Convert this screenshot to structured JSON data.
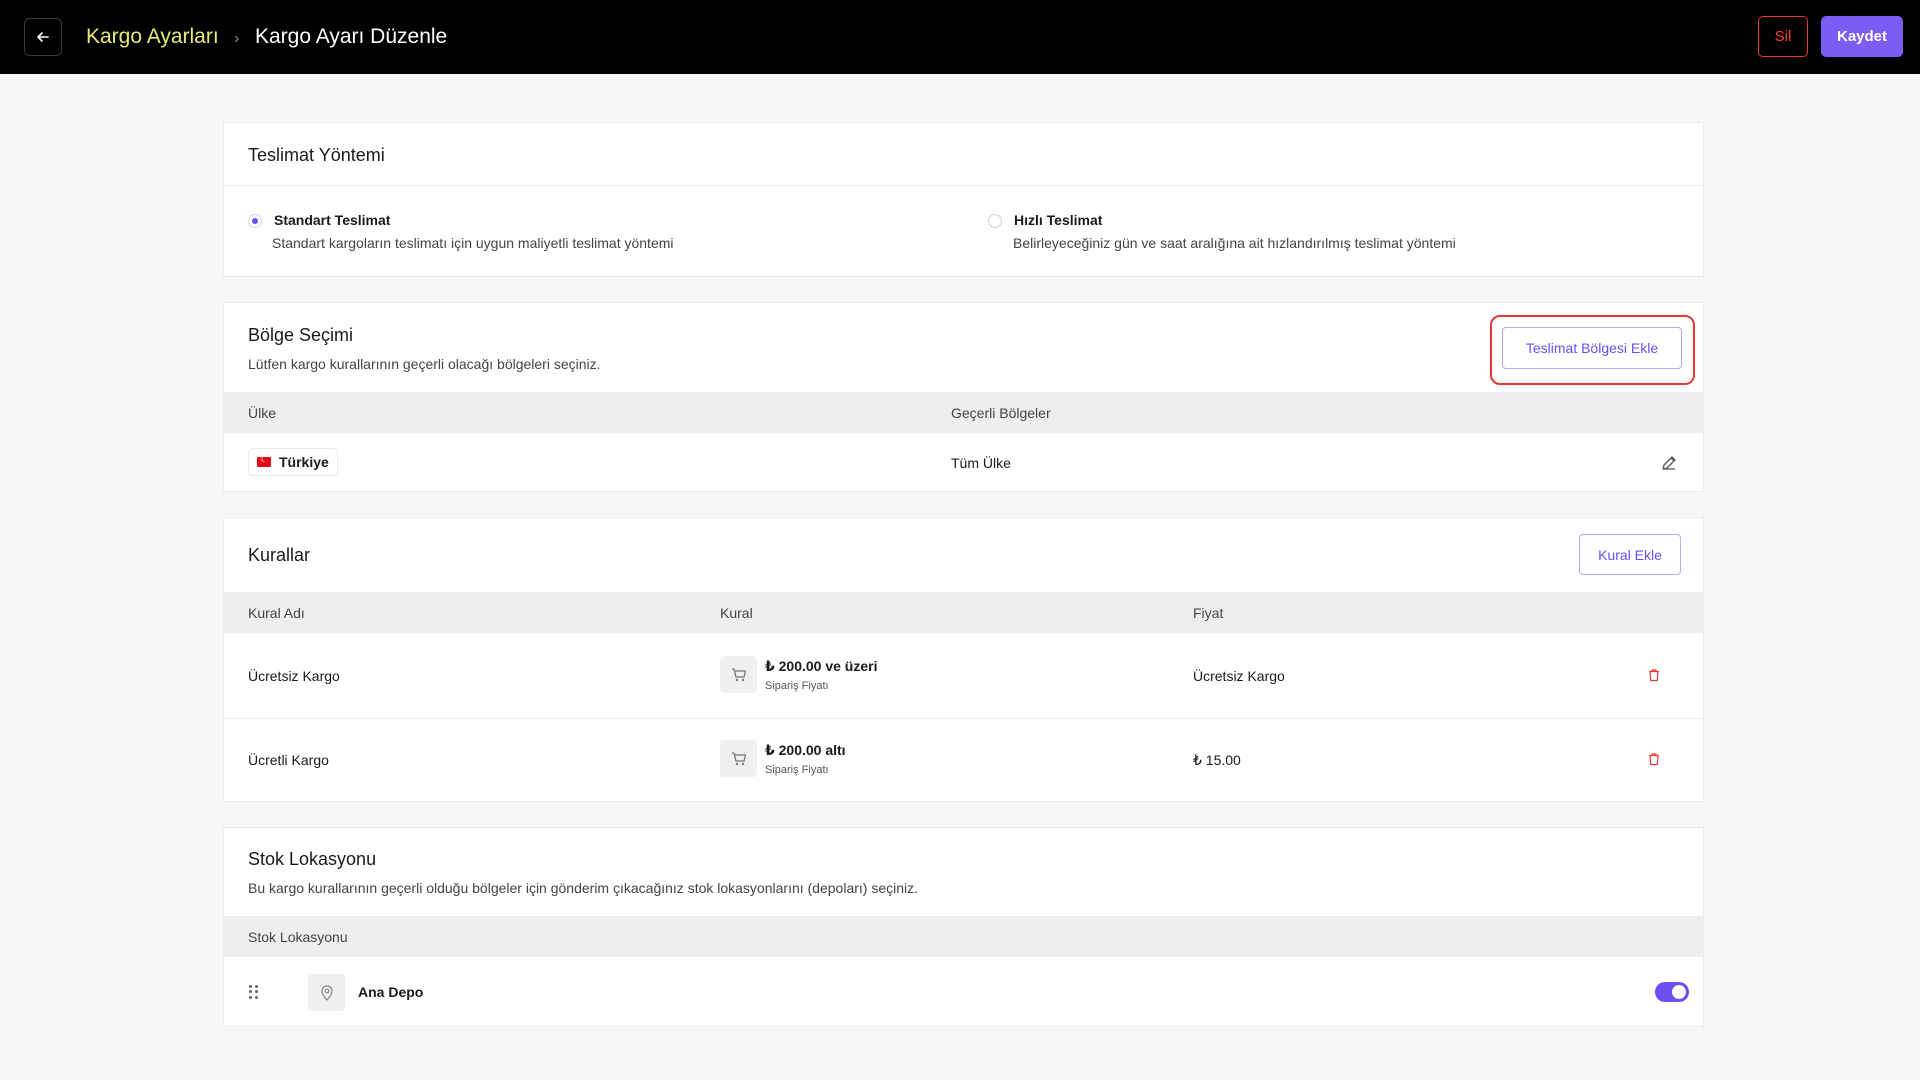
{
  "header": {
    "back_icon": "arrow-left-icon",
    "breadcrumb_parent": "Kargo Ayarları",
    "breadcrumb_separator": "›",
    "breadcrumb_current": "Kargo Ayarı Düzenle",
    "delete_label": "Sil",
    "save_label": "Kaydet"
  },
  "delivery_method": {
    "title": "Teslimat Yöntemi",
    "options": [
      {
        "label": "Standart Teslimat",
        "description": "Standart kargoların teslimatı için uygun maliyetli teslimat yöntemi",
        "selected": true
      },
      {
        "label": "Hızlı Teslimat",
        "description": "Belirleyeceğiniz gün ve saat aralığına ait hızlandırılmış teslimat yöntemi",
        "selected": false
      }
    ]
  },
  "region": {
    "title": "Bölge Seçimi",
    "subtitle": "Lütfen kargo kurallarının geçerli olacağı bölgeleri seçiniz.",
    "add_button": "Teslimat Bölgesi Ekle",
    "columns": [
      "Ülke",
      "Geçerli Bölgeler"
    ],
    "rows": [
      {
        "country": "Türkiye",
        "regions": "Tüm Ülke"
      }
    ]
  },
  "rules": {
    "title": "Kurallar",
    "add_button": "Kural Ekle",
    "columns": [
      "Kural Adı",
      "Kural",
      "Fiyat"
    ],
    "rows": [
      {
        "name": "Ücretsiz Kargo",
        "rule": "₺ 200.00 ve üzeri",
        "rule_sub": "Sipariş Fiyatı",
        "price": "Ücretsiz Kargo"
      },
      {
        "name": "Ücretli Kargo",
        "rule": "₺ 200.00 altı",
        "rule_sub": "Sipariş Fiyatı",
        "price": "₺ 15.00"
      }
    ]
  },
  "stock": {
    "title": "Stok Lokasyonu",
    "subtitle": "Bu kargo kurallarının geçerli olduğu bölgeler için gönderim çıkacağınız stok lokasyonlarını (depoları) seçiniz.",
    "column": "Stok Lokasyonu",
    "rows": [
      {
        "name": "Ana Depo",
        "enabled": true
      }
    ]
  },
  "colors": {
    "accent": "#7b5cf5",
    "danger": "#e53935",
    "breadcrumb_parent": "#e8ea76"
  }
}
